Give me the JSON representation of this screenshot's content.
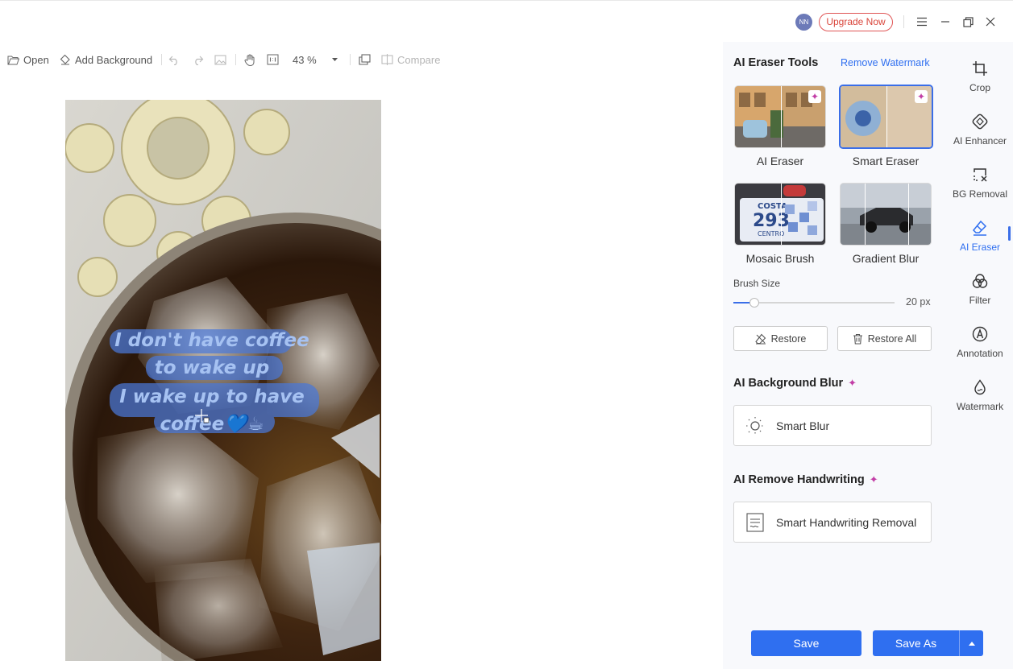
{
  "titlebar": {
    "avatar_initials": "NN",
    "upgrade_label": "Upgrade Now"
  },
  "toolbar": {
    "open_label": "Open",
    "add_background_label": "Add Background",
    "zoom_value": "43 %",
    "compare_label": "Compare"
  },
  "canvas": {
    "overlay_lines": [
      "I don't have coffee",
      "to wake up",
      "I wake up to have",
      "coffee💙☕"
    ]
  },
  "panel": {
    "eraser_title": "AI Eraser Tools",
    "remove_watermark_link": "Remove Watermark",
    "tools": [
      {
        "label": "AI Eraser"
      },
      {
        "label": "Smart Eraser"
      },
      {
        "label": "Mosaic Brush"
      },
      {
        "label": "Gradient Blur"
      }
    ],
    "mosaic_plate_text": [
      "COSTA",
      "293",
      "CENTRO"
    ],
    "brush_size_label": "Brush Size",
    "brush_size_value": "20",
    "brush_size_unit": "px",
    "brush_size_fraction": 0.13,
    "restore_label": "Restore",
    "restore_all_label": "Restore All",
    "bg_blur_title": "AI Background Blur",
    "smart_blur_label": "Smart Blur",
    "handwriting_title": "AI Remove Handwriting",
    "handwriting_option_label": "Smart Handwriting Removal"
  },
  "sidenav": {
    "items": [
      {
        "label": "Crop",
        "icon": "crop-icon"
      },
      {
        "label": "AI Enhancer",
        "icon": "ai-enhancer-icon"
      },
      {
        "label": "BG Removal",
        "icon": "bg-removal-icon"
      },
      {
        "label": "AI Eraser",
        "icon": "eraser-icon",
        "active": true
      },
      {
        "label": "Filter",
        "icon": "filter-icon"
      },
      {
        "label": "Annotation",
        "icon": "annotation-icon"
      },
      {
        "label": "Watermark",
        "icon": "watermark-icon"
      }
    ]
  },
  "footer": {
    "save_label": "Save",
    "save_as_label": "Save As"
  },
  "colors": {
    "accent": "#2f6ff0",
    "upgrade": "#d9453b",
    "sparkle": "#c23ea6",
    "highlight": "#4a78d8"
  }
}
